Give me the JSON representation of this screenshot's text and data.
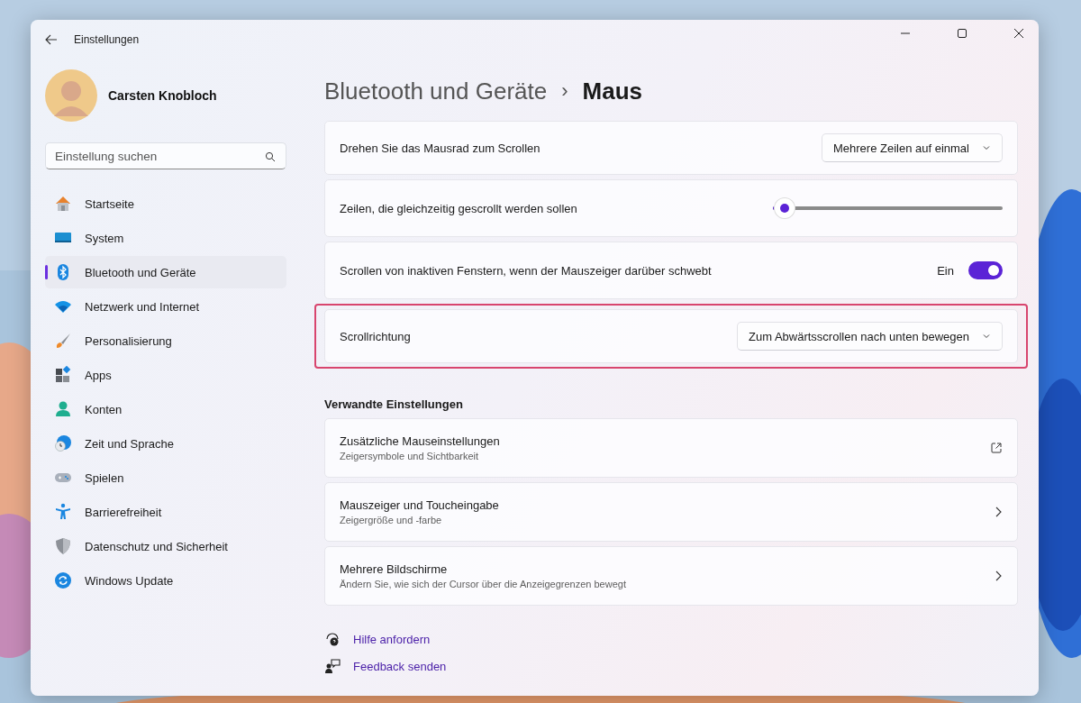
{
  "window": {
    "title": "Einstellungen"
  },
  "user": {
    "name": "Carsten Knobloch"
  },
  "search": {
    "placeholder": "Einstellung suchen"
  },
  "sidebar": {
    "items": [
      {
        "label": "Startseite",
        "selected": false
      },
      {
        "label": "System",
        "selected": false
      },
      {
        "label": "Bluetooth und Geräte",
        "selected": true
      },
      {
        "label": "Netzwerk und Internet",
        "selected": false
      },
      {
        "label": "Personalisierung",
        "selected": false
      },
      {
        "label": "Apps",
        "selected": false
      },
      {
        "label": "Konten",
        "selected": false
      },
      {
        "label": "Zeit und Sprache",
        "selected": false
      },
      {
        "label": "Spielen",
        "selected": false
      },
      {
        "label": "Barrierefreiheit",
        "selected": false
      },
      {
        "label": "Datenschutz und Sicherheit",
        "selected": false
      },
      {
        "label": "Windows Update",
        "selected": false
      }
    ]
  },
  "breadcrumb": {
    "parent": "Bluetooth und Geräte",
    "separator": "›",
    "current": "Maus"
  },
  "settings": [
    {
      "kind": "dropdown",
      "label": "Drehen Sie das Mausrad zum Scrollen",
      "value": "Mehrere Zeilen auf einmal",
      "highlighted": false
    },
    {
      "kind": "slider",
      "label": "Zeilen, die gleichzeitig gescrollt werden sollen",
      "level": 0.05,
      "highlighted": false
    },
    {
      "kind": "toggle",
      "label": "Scrollen von inaktiven Fenstern, wenn der Mauszeiger darüber schwebt",
      "state_text": "Ein",
      "on": true,
      "highlighted": false
    },
    {
      "kind": "dropdown",
      "label": "Scrollrichtung",
      "value": "Zum Abwärtsscrollen nach unten bewegen",
      "highlighted": true
    }
  ],
  "related": {
    "title": "Verwandte Einstellungen",
    "items": [
      {
        "kind": "external",
        "title": "Zusätzliche Mauseinstellungen",
        "subtitle": "Zeigersymbole und Sichtbarkeit"
      },
      {
        "kind": "chevron",
        "title": "Mauszeiger und Toucheingabe",
        "subtitle": "Zeigergröße und -farbe"
      },
      {
        "kind": "chevron",
        "title": "Mehrere Bildschirme",
        "subtitle": "Ändern Sie, wie sich der Cursor über die Anzeigegrenzen bewegt"
      }
    ]
  },
  "links": [
    {
      "kind": "help",
      "label": "Hilfe anfordern"
    },
    {
      "kind": "feedback",
      "label": "Feedback senden"
    }
  ]
}
